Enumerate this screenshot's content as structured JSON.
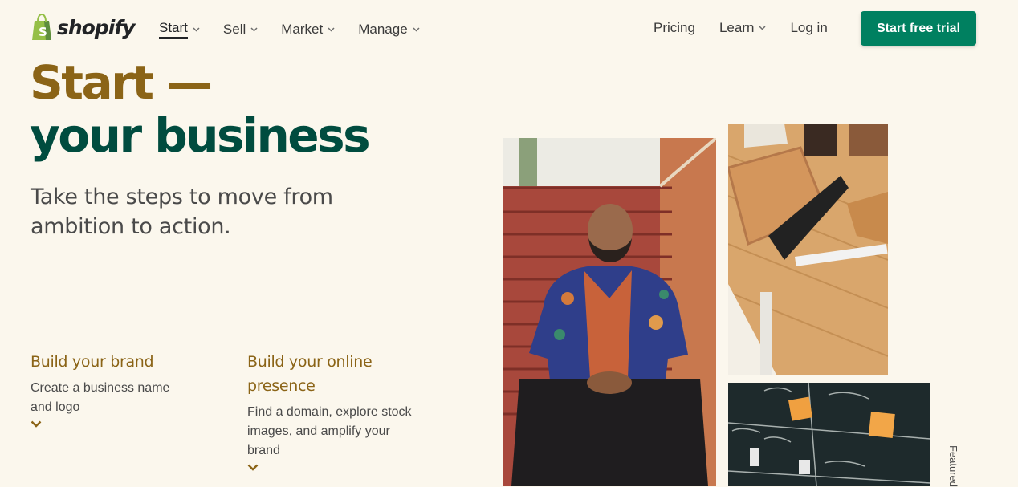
{
  "header": {
    "logo_text": "shopify",
    "nav_left": [
      {
        "label": "Start",
        "active": true
      },
      {
        "label": "Sell"
      },
      {
        "label": "Market"
      },
      {
        "label": "Manage"
      }
    ],
    "nav_right": {
      "pricing": "Pricing",
      "learn": "Learn",
      "login": "Log in"
    },
    "cta_label": "Start free trial"
  },
  "hero": {
    "title_line1": "Start —",
    "title_line2": "your business",
    "subtitle": "Take the steps to move from ambition to action."
  },
  "steps": [
    {
      "title": "Build your brand",
      "desc": "Create a business name and logo"
    },
    {
      "title": "Build your online presence",
      "desc": "Find a domain, explore stock images, and amplify your brand"
    }
  ],
  "featured_label": "Featured",
  "colors": {
    "background": "#fbf7ed",
    "brand_green": "#008060",
    "title_gold": "#8b6417",
    "title_dark_green": "#004c3f"
  },
  "icons": [
    "shopify-bag-icon",
    "chevron-down-icon"
  ]
}
